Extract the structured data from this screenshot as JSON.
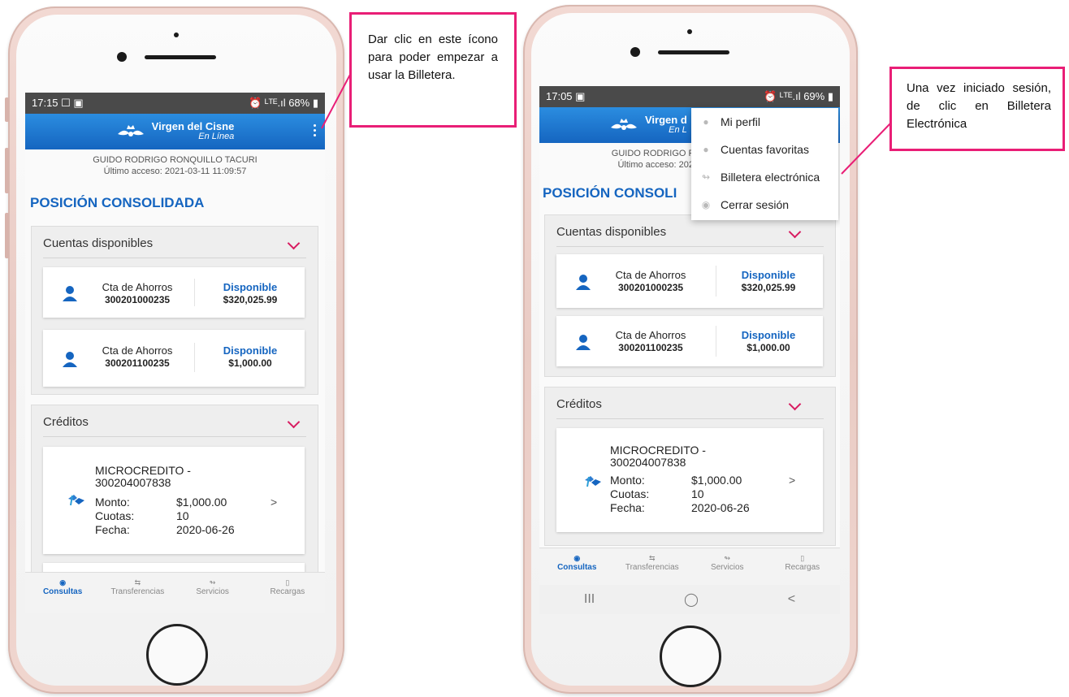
{
  "left": {
    "status_time": "17:15 ☐ ▣",
    "status_right": "⏰ ᴸᵀᴱ.ıl 68% ▮",
    "app": {
      "brand": "Virgen del Cisne",
      "brand_sub": "En Línea"
    },
    "user_name": "GUIDO RODRIGO RONQUILLO TACURI",
    "last_access": "Último acceso: 2021-03-11 11:09:57",
    "section_title": "POSICIÓN CONSOLIDADA",
    "cuentas_title": "Cuentas disponibles",
    "accounts": [
      {
        "type": "Cta de Ahorros",
        "number": "300201000235",
        "label": "Disponible",
        "amount": "$320,025.99"
      },
      {
        "type": "Cta de Ahorros",
        "number": "300201100235",
        "label": "Disponible",
        "amount": "$1,000.00"
      }
    ],
    "creditos_title": "Créditos",
    "credit": {
      "title1": "MICROCREDITO -",
      "title2": "300204007838",
      "monto_label": "Monto:",
      "monto": "$1,000.00",
      "cuotas_label": "Cuotas:",
      "cuotas": "10",
      "fecha_label": "Fecha:",
      "fecha": "2020-06-26"
    },
    "nav": [
      "Consultas",
      "Transferencias",
      "Servicios",
      "Recargas"
    ]
  },
  "right": {
    "status_time": "17:05 ▣",
    "status_right": "⏰ ᴸᵀᴱ.ıl 69% ▮",
    "app": {
      "brand": "Virgen d",
      "brand_sub": "En L"
    },
    "user_name": "GUIDO RODRIGO RO",
    "last_access": "Último acceso: 202",
    "section_title": "POSICIÓN CONSOLI",
    "cuentas_title": "Cuentas disponibles",
    "accounts": [
      {
        "type": "Cta de Ahorros",
        "number": "300201000235",
        "label": "Disponible",
        "amount": "$320,025.99"
      },
      {
        "type": "Cta de Ahorros",
        "number": "300201100235",
        "label": "Disponible",
        "amount": "$1,000.00"
      }
    ],
    "creditos_title": "Créditos",
    "credit": {
      "title1": "MICROCREDITO -",
      "title2": "300204007838",
      "monto_label": "Monto:",
      "monto": "$1,000.00",
      "cuotas_label": "Cuotas:",
      "cuotas": "10",
      "fecha_label": "Fecha:",
      "fecha": "2020-06-26"
    },
    "menu": [
      "Mi perfil",
      "Cuentas favoritas",
      "Billetera electrónica",
      "Cerrar sesión"
    ],
    "nav": [
      "Consultas",
      "Transferencias",
      "Servicios",
      "Recargas"
    ],
    "sysnav": [
      "III",
      "◯",
      "<"
    ]
  },
  "callouts": {
    "left": "Dar clic en este ícono para poder empezar a usar la Billetera.",
    "right": "Una vez iniciado sesión, de clic en Billetera Electrónica"
  },
  "colors": {
    "accent": "#1565c0",
    "callout_border": "#e91e76",
    "chevron": "#d81b60"
  }
}
